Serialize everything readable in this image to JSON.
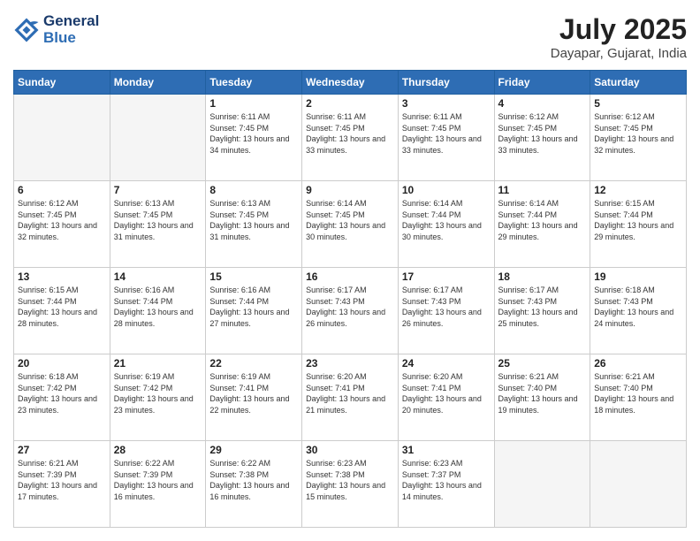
{
  "header": {
    "logo_line1": "General",
    "logo_line2": "Blue",
    "main_title": "July 2025",
    "subtitle": "Dayapar, Gujarat, India"
  },
  "days_of_week": [
    "Sunday",
    "Monday",
    "Tuesday",
    "Wednesday",
    "Thursday",
    "Friday",
    "Saturday"
  ],
  "weeks": [
    [
      {
        "day": "",
        "empty": true
      },
      {
        "day": "",
        "empty": true
      },
      {
        "day": "1",
        "sunrise": "Sunrise: 6:11 AM",
        "sunset": "Sunset: 7:45 PM",
        "daylight": "Daylight: 13 hours and 34 minutes."
      },
      {
        "day": "2",
        "sunrise": "Sunrise: 6:11 AM",
        "sunset": "Sunset: 7:45 PM",
        "daylight": "Daylight: 13 hours and 33 minutes."
      },
      {
        "day": "3",
        "sunrise": "Sunrise: 6:11 AM",
        "sunset": "Sunset: 7:45 PM",
        "daylight": "Daylight: 13 hours and 33 minutes."
      },
      {
        "day": "4",
        "sunrise": "Sunrise: 6:12 AM",
        "sunset": "Sunset: 7:45 PM",
        "daylight": "Daylight: 13 hours and 33 minutes."
      },
      {
        "day": "5",
        "sunrise": "Sunrise: 6:12 AM",
        "sunset": "Sunset: 7:45 PM",
        "daylight": "Daylight: 13 hours and 32 minutes."
      }
    ],
    [
      {
        "day": "6",
        "sunrise": "Sunrise: 6:12 AM",
        "sunset": "Sunset: 7:45 PM",
        "daylight": "Daylight: 13 hours and 32 minutes."
      },
      {
        "day": "7",
        "sunrise": "Sunrise: 6:13 AM",
        "sunset": "Sunset: 7:45 PM",
        "daylight": "Daylight: 13 hours and 31 minutes."
      },
      {
        "day": "8",
        "sunrise": "Sunrise: 6:13 AM",
        "sunset": "Sunset: 7:45 PM",
        "daylight": "Daylight: 13 hours and 31 minutes."
      },
      {
        "day": "9",
        "sunrise": "Sunrise: 6:14 AM",
        "sunset": "Sunset: 7:45 PM",
        "daylight": "Daylight: 13 hours and 30 minutes."
      },
      {
        "day": "10",
        "sunrise": "Sunrise: 6:14 AM",
        "sunset": "Sunset: 7:44 PM",
        "daylight": "Daylight: 13 hours and 30 minutes."
      },
      {
        "day": "11",
        "sunrise": "Sunrise: 6:14 AM",
        "sunset": "Sunset: 7:44 PM",
        "daylight": "Daylight: 13 hours and 29 minutes."
      },
      {
        "day": "12",
        "sunrise": "Sunrise: 6:15 AM",
        "sunset": "Sunset: 7:44 PM",
        "daylight": "Daylight: 13 hours and 29 minutes."
      }
    ],
    [
      {
        "day": "13",
        "sunrise": "Sunrise: 6:15 AM",
        "sunset": "Sunset: 7:44 PM",
        "daylight": "Daylight: 13 hours and 28 minutes."
      },
      {
        "day": "14",
        "sunrise": "Sunrise: 6:16 AM",
        "sunset": "Sunset: 7:44 PM",
        "daylight": "Daylight: 13 hours and 28 minutes."
      },
      {
        "day": "15",
        "sunrise": "Sunrise: 6:16 AM",
        "sunset": "Sunset: 7:44 PM",
        "daylight": "Daylight: 13 hours and 27 minutes."
      },
      {
        "day": "16",
        "sunrise": "Sunrise: 6:17 AM",
        "sunset": "Sunset: 7:43 PM",
        "daylight": "Daylight: 13 hours and 26 minutes."
      },
      {
        "day": "17",
        "sunrise": "Sunrise: 6:17 AM",
        "sunset": "Sunset: 7:43 PM",
        "daylight": "Daylight: 13 hours and 26 minutes."
      },
      {
        "day": "18",
        "sunrise": "Sunrise: 6:17 AM",
        "sunset": "Sunset: 7:43 PM",
        "daylight": "Daylight: 13 hours and 25 minutes."
      },
      {
        "day": "19",
        "sunrise": "Sunrise: 6:18 AM",
        "sunset": "Sunset: 7:43 PM",
        "daylight": "Daylight: 13 hours and 24 minutes."
      }
    ],
    [
      {
        "day": "20",
        "sunrise": "Sunrise: 6:18 AM",
        "sunset": "Sunset: 7:42 PM",
        "daylight": "Daylight: 13 hours and 23 minutes."
      },
      {
        "day": "21",
        "sunrise": "Sunrise: 6:19 AM",
        "sunset": "Sunset: 7:42 PM",
        "daylight": "Daylight: 13 hours and 23 minutes."
      },
      {
        "day": "22",
        "sunrise": "Sunrise: 6:19 AM",
        "sunset": "Sunset: 7:41 PM",
        "daylight": "Daylight: 13 hours and 22 minutes."
      },
      {
        "day": "23",
        "sunrise": "Sunrise: 6:20 AM",
        "sunset": "Sunset: 7:41 PM",
        "daylight": "Daylight: 13 hours and 21 minutes."
      },
      {
        "day": "24",
        "sunrise": "Sunrise: 6:20 AM",
        "sunset": "Sunset: 7:41 PM",
        "daylight": "Daylight: 13 hours and 20 minutes."
      },
      {
        "day": "25",
        "sunrise": "Sunrise: 6:21 AM",
        "sunset": "Sunset: 7:40 PM",
        "daylight": "Daylight: 13 hours and 19 minutes."
      },
      {
        "day": "26",
        "sunrise": "Sunrise: 6:21 AM",
        "sunset": "Sunset: 7:40 PM",
        "daylight": "Daylight: 13 hours and 18 minutes."
      }
    ],
    [
      {
        "day": "27",
        "sunrise": "Sunrise: 6:21 AM",
        "sunset": "Sunset: 7:39 PM",
        "daylight": "Daylight: 13 hours and 17 minutes."
      },
      {
        "day": "28",
        "sunrise": "Sunrise: 6:22 AM",
        "sunset": "Sunset: 7:39 PM",
        "daylight": "Daylight: 13 hours and 16 minutes."
      },
      {
        "day": "29",
        "sunrise": "Sunrise: 6:22 AM",
        "sunset": "Sunset: 7:38 PM",
        "daylight": "Daylight: 13 hours and 16 minutes."
      },
      {
        "day": "30",
        "sunrise": "Sunrise: 6:23 AM",
        "sunset": "Sunset: 7:38 PM",
        "daylight": "Daylight: 13 hours and 15 minutes."
      },
      {
        "day": "31",
        "sunrise": "Sunrise: 6:23 AM",
        "sunset": "Sunset: 7:37 PM",
        "daylight": "Daylight: 13 hours and 14 minutes."
      },
      {
        "day": "",
        "empty": true
      },
      {
        "day": "",
        "empty": true
      }
    ]
  ]
}
